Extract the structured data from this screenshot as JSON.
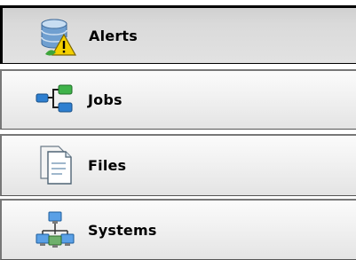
{
  "nav": {
    "items": [
      {
        "label": "Alerts",
        "icon": "alerts-database-warning-icon",
        "active": true
      },
      {
        "label": "Jobs",
        "icon": "jobs-flow-icon",
        "active": false
      },
      {
        "label": "Files",
        "icon": "files-documents-icon",
        "active": false
      },
      {
        "label": "Systems",
        "icon": "systems-network-icon",
        "active": false
      }
    ]
  },
  "colors": {
    "active_border": "#000000",
    "inactive_border": "#777777",
    "tab_gradient_top": "#fbfbfb",
    "tab_gradient_bottom": "#e4e4e4"
  }
}
